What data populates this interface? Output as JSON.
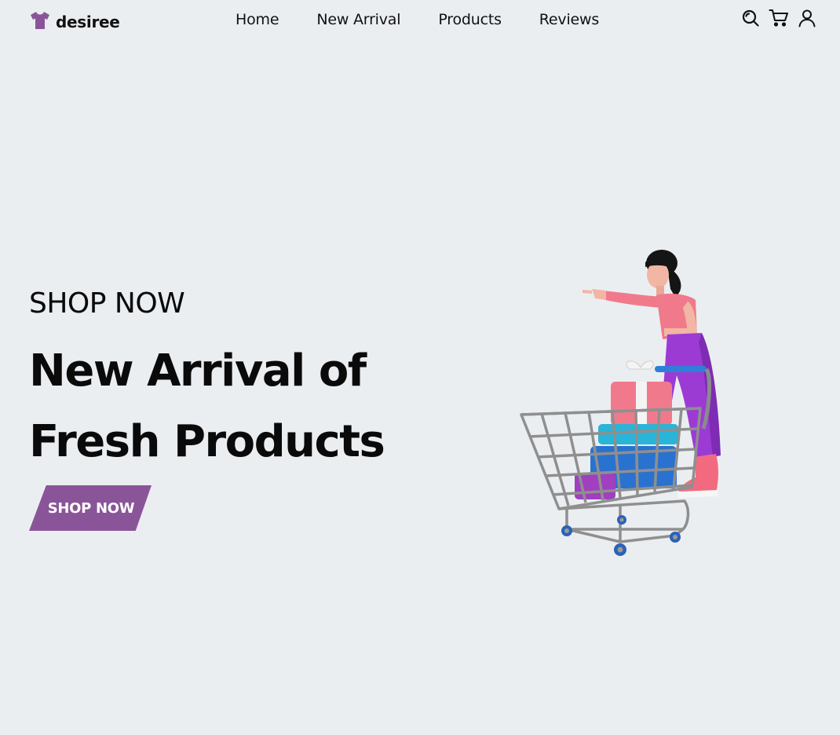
{
  "brand": {
    "name": "desiree",
    "icon": "tshirt-icon",
    "color": "#8a5598"
  },
  "nav": {
    "items": [
      {
        "label": "Home"
      },
      {
        "label": "New Arrival"
      },
      {
        "label": "Products"
      },
      {
        "label": "Reviews"
      }
    ]
  },
  "header_icons": [
    "search-icon",
    "cart-icon",
    "user-icon"
  ],
  "hero": {
    "kicker": "SHOP NOW",
    "title_line1": "New Arrival of",
    "title_line2": "Fresh Products",
    "cta_label": "SHOP NOW",
    "cta_color": "#8a5598",
    "illustration": "woman-with-shopping-cart-illustration"
  },
  "colors": {
    "background": "#ebeef1",
    "text": "#0b0b0b",
    "accent": "#8a5598"
  }
}
